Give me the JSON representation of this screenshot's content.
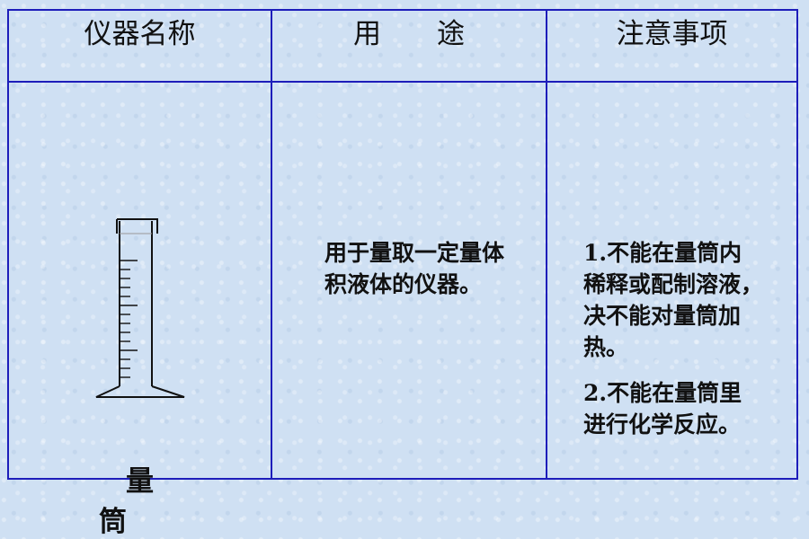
{
  "headers": {
    "instrument_name": "仪器名称",
    "usage": "用　　途",
    "precautions": "注意事项"
  },
  "instrument": {
    "name": "量　筒",
    "icon": "graduated-cylinder-icon"
  },
  "usage_text": "用于量取一定量体积液体的仪器。",
  "precautions": [
    "1.不能在量筒内稀释或配制溶液，决不能对量筒加热。",
    "2.不能在量筒里进行化学反应。"
  ],
  "colors": {
    "background": "#cfe0f3",
    "table_border": "#1d1dba",
    "text": "#111111"
  }
}
